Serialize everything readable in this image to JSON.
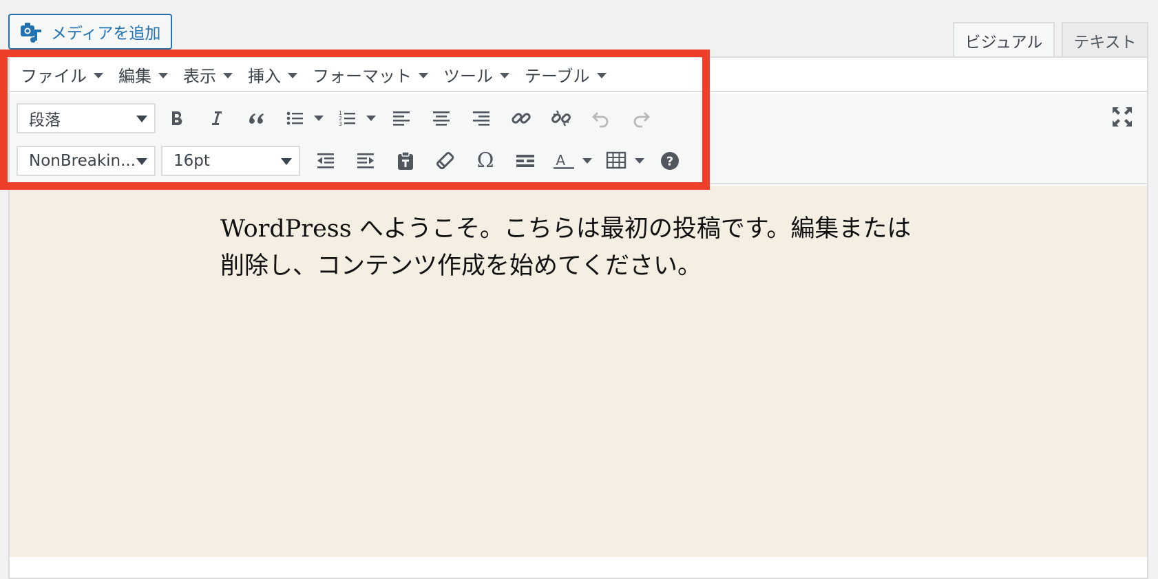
{
  "top": {
    "add_media_label": "メディアを追加",
    "tab_visual": "ビジュアル",
    "tab_text": "テキスト"
  },
  "menubar": {
    "items": [
      "ファイル",
      "編集",
      "表示",
      "挿入",
      "フォーマット",
      "ツール",
      "テーブル"
    ]
  },
  "toolbar": {
    "format_select": "段落",
    "font_family_select": "NonBreakin...",
    "font_size_select": "16pt",
    "row1_icons": [
      "bold-icon",
      "italic-icon",
      "blockquote-icon",
      "bulleted-list-icon",
      "numbered-list-icon",
      "align-left-icon",
      "align-center-icon",
      "align-right-icon",
      "link-icon",
      "unlink-icon",
      "undo-icon",
      "redo-icon",
      "fullscreen-icon"
    ],
    "row2_icons": [
      "outdent-icon",
      "indent-icon",
      "paste-text-icon",
      "clear-formatting-icon",
      "special-character-icon",
      "horizontal-line-icon",
      "text-color-icon",
      "table-icon",
      "help-icon"
    ]
  },
  "content": {
    "line1": "WordPress へようこそ。こちらは最初の投稿です。編集または",
    "line2": "削除し、コンテンツ作成を始めてください。"
  },
  "colors": {
    "highlight_border": "#ee3f28",
    "link_blue": "#2271b1",
    "content_background": "#f5eee3"
  }
}
